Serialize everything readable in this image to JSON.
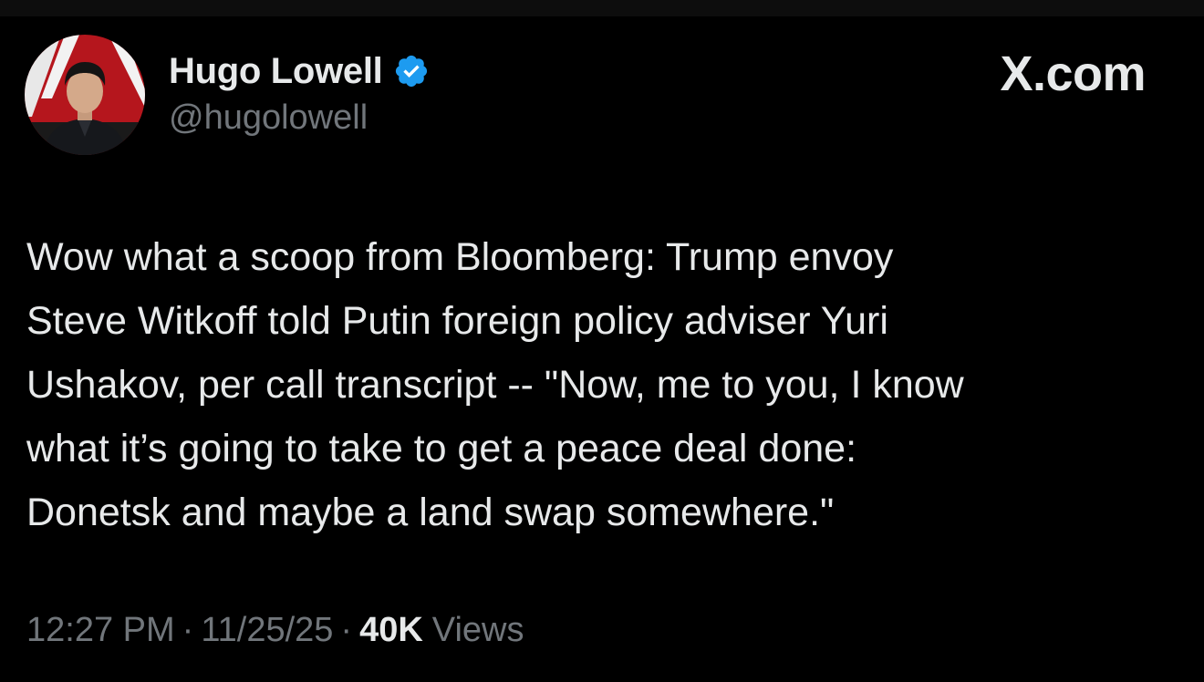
{
  "site": {
    "mark": "X.com"
  },
  "author": {
    "name": "Hugo Lowell",
    "handle": "@hugolowell",
    "verified": true,
    "badge_icon": "verified-check-icon",
    "badge_color": "#1d9bf0"
  },
  "tweet": {
    "lines": [
      "Wow what a scoop from Bloomberg: Trump envoy",
      "Steve Witkoff told Putin foreign policy adviser Yuri",
      "Ushakov, per call transcript -- \"Now, me to you, I know",
      "what it’s going to take to get a peace deal done:",
      "Donetsk and maybe a land swap somewhere.\""
    ]
  },
  "meta": {
    "time": "12:27 PM",
    "separator": "·",
    "date": "11/25/25",
    "views_count": "40K",
    "views_label": "Views"
  },
  "colors": {
    "background": "#000000",
    "primary_text": "#e7e9ea",
    "secondary_text": "#71767b",
    "accent": "#1d9bf0"
  }
}
